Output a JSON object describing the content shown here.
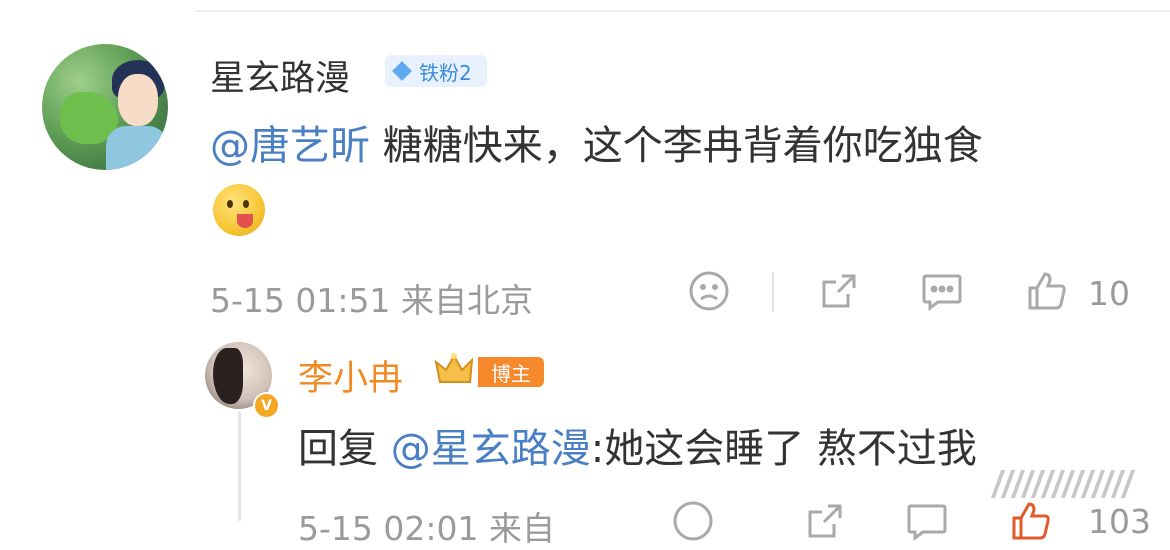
{
  "comment": {
    "username": "星玄路漫",
    "fan_badge": "铁粉2",
    "mention": "@唐艺昕",
    "text": " 糖糖快来，这个李冉背着你吃独食",
    "emoji": "yum-face-emoji",
    "time": "5-15 01:51",
    "location": "来自北京",
    "like_count": "10"
  },
  "reply": {
    "username": "李小冉",
    "badge": "博主",
    "prefix": "回复",
    "mention": "@星玄路漫",
    "text": ":她这会睡了 熬不过我",
    "time": "5-15 02:01",
    "location": "来自",
    "like_count": "103"
  },
  "icons": {
    "dislike": "sad-face-icon",
    "share": "share-icon",
    "comment": "comment-icon",
    "like": "thumbs-up-icon"
  },
  "colors": {
    "mention": "#4a7fc3",
    "blogger_name": "#f08a24",
    "blogger_badge": "#f7892d",
    "fan_badge_text": "#3c8bd8",
    "meta_text": "#9a9a9a"
  }
}
